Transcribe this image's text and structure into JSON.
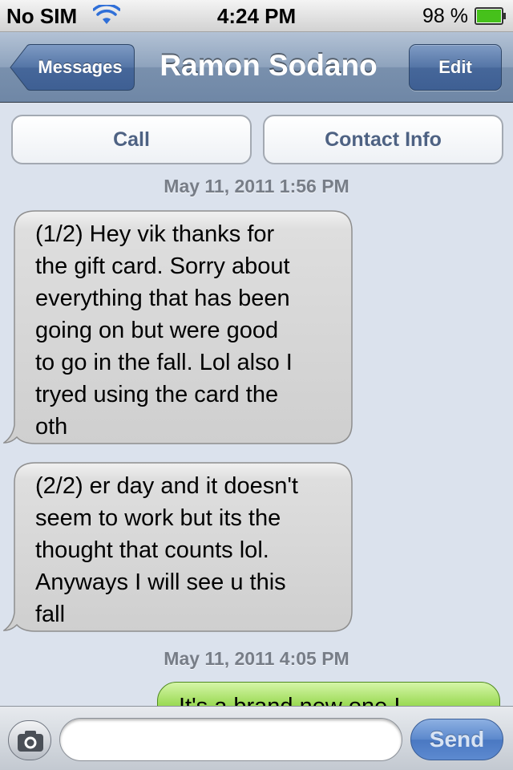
{
  "status_bar": {
    "carrier": "No SIM",
    "time": "4:24 PM",
    "battery_percent": "98 %",
    "wifi_icon": "wifi-icon",
    "battery_icon": "battery-icon",
    "battery_color": "#46c11b"
  },
  "nav_bar": {
    "back_label": "Messages",
    "title": "Ramon Sodano",
    "edit_label": "Edit"
  },
  "actions": {
    "call_label": "Call",
    "contact_info_label": "Contact Info"
  },
  "conversation": {
    "timestamps": [
      "May 11, 2011 1:56 PM",
      "May 11, 2011 4:05 PM"
    ],
    "messages": [
      {
        "direction": "incoming",
        "text": "(1/2) Hey vik thanks for\nthe gift card.  Sorry about\neverything that has been\ngoing on but were good\nto go in the fall.  Lol also I\ntryed using the card the\noth"
      },
      {
        "direction": "incoming",
        "text": "(2/2) er day and it doesn't\nseem to work but its the\nthought that counts lol.\nAnyways I will see u this\nfall"
      },
      {
        "direction": "outgoing",
        "text": "It's a brand new one I",
        "color": "#8fd14a"
      }
    ]
  },
  "input_bar": {
    "camera_icon": "camera-icon",
    "message_value": "",
    "send_label": "Send"
  }
}
